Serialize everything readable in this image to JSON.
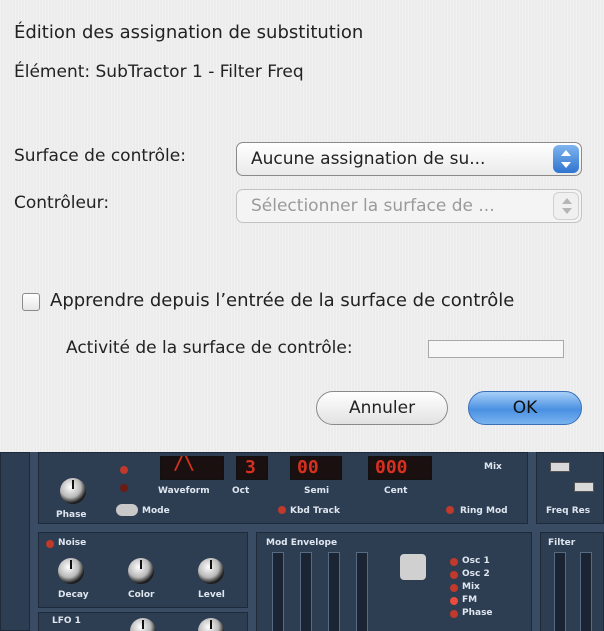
{
  "dialog": {
    "title": "Édition des assignation de substitution",
    "element_label": "Élément: SubTractor 1 - Filter Freq",
    "surface_label": "Surface de contrôle:",
    "surface_value": "Aucune assignation de su...",
    "controller_label": "Contrôleur:",
    "controller_value": "Sélectionner la surface de ...",
    "learn_label": "Apprendre depuis l’entrée de la surface de contrôle",
    "activity_label": "Activité de la surface de contrôle:",
    "cancel_label": "Annuler",
    "ok_label": "OK"
  },
  "synth": {
    "osc_labels": {
      "phase": "Phase",
      "mode": "Mode",
      "waveform": "Waveform",
      "oct": "Oct",
      "semi": "Semi",
      "cent": "Cent",
      "mix": "Mix",
      "kbd_track": "Kbd Track",
      "ring_mod": "Ring Mod",
      "freq_res": "Freq Res"
    },
    "noise": {
      "title": "Noise",
      "decay": "Decay",
      "color": "Color",
      "level": "Level"
    },
    "mod_envelope": {
      "title": "Mod Envelope",
      "targets": [
        "Osc 1",
        "Osc 2",
        "Mix",
        "FM",
        "Phase"
      ]
    },
    "filter_title": "Filter",
    "lfo_title": "LFO 1",
    "colors": {
      "panel": "#3a4c63",
      "led": "#c0392b",
      "lcd_text": "#d63020",
      "ok_button": "#4a90e2"
    }
  }
}
